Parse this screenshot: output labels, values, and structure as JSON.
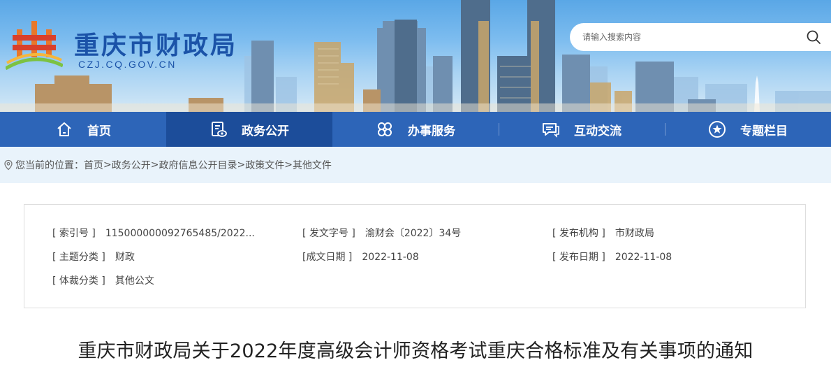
{
  "header": {
    "site_title": "重庆市财政局",
    "site_domain": "CZJ.CQ.GOV.CN",
    "logo_icon": "cq-finance-emblem-icon",
    "search": {
      "placeholder": "请输入搜索内容",
      "icon": "search-icon"
    }
  },
  "nav": {
    "items": [
      {
        "label": "首页",
        "icon": "home-icon"
      },
      {
        "label": "政务公开",
        "icon": "document-eye-icon",
        "active": true
      },
      {
        "label": "办事服务",
        "icon": "clover-icon"
      },
      {
        "label": "互动交流",
        "icon": "chat-icon"
      },
      {
        "label": "专题栏目",
        "icon": "star-icon"
      }
    ]
  },
  "breadcrumb": {
    "prefix": "您当前的位置：",
    "icon": "location-icon",
    "items": [
      "首页",
      "政务公开",
      "政府信息公开目录",
      "政策文件",
      "其他文件"
    ],
    "separator": ">"
  },
  "info": {
    "index_key": "[ 索引号 ]",
    "index_val": "115000000092765485/2022...",
    "docno_key": "[ 发文字号 ]",
    "docno_val": "渝财会〔2022〕34号",
    "issuer_key": "[ 发布机构 ]",
    "issuer_val": "市财政局",
    "topic_key": "[ 主题分类 ]",
    "topic_val": "财政",
    "created_key": "[成文日期 ]",
    "created_val": "2022-11-08",
    "published_key": "[ 发布日期 ]",
    "published_val": "2022-11-08",
    "genre_key": "[ 体裁分类 ]",
    "genre_val": "其他公文"
  },
  "document": {
    "title": "重庆市财政局关于2022年度高级会计师资格考试重庆合格标准及有关事项的通知"
  },
  "colors": {
    "brand_blue": "#1b53a8",
    "nav_blue": "#2d65b8",
    "nav_active": "#1c4d9a",
    "breadcrumb_bg": "#e9f3fb"
  }
}
